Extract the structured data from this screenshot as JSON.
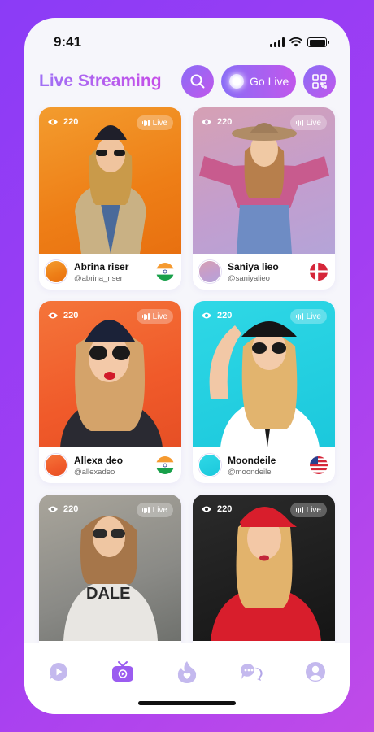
{
  "status": {
    "time": "9:41"
  },
  "header": {
    "title": "Live Streaming",
    "go_live_label": "Go Live"
  },
  "live_label": "Live",
  "streams": [
    {
      "views": "220",
      "name": "Abrina riser",
      "handle": "@abrina_riser",
      "flag": "india"
    },
    {
      "views": "220",
      "name": "Saniya lieo",
      "handle": "@saniyalieo",
      "flag": "denmark"
    },
    {
      "views": "220",
      "name": "Allexa deo",
      "handle": "@allexadeo",
      "flag": "india"
    },
    {
      "views": "220",
      "name": "Moondeile",
      "handle": "@moondeile",
      "flag": "usa"
    },
    {
      "views": "220"
    },
    {
      "views": "220"
    }
  ],
  "tabs": [
    "play-chat-icon",
    "live-tv-icon",
    "fire-heart-icon",
    "chats-icon",
    "profile-icon"
  ],
  "colors": {
    "accent": "#a76cf2",
    "accent_end": "#c157ec",
    "tab_inactive": "#c4b9ee",
    "tab_active": "#9b5cf0"
  }
}
